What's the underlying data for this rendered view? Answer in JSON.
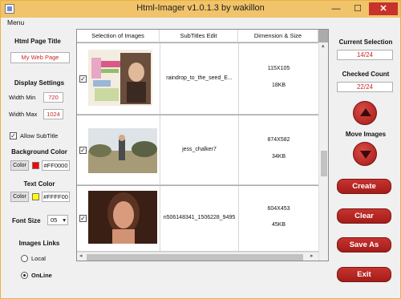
{
  "window": {
    "title": "Html-Imager v1.0.1.3 by wakillon",
    "controls": {
      "minimize": "—",
      "maximize": "☐",
      "close": "✕"
    }
  },
  "menu": {
    "label": "Menu"
  },
  "settings": {
    "page_title_label": "Html Page Title",
    "page_title_value": "My Web Page",
    "display_label": "Display Settings",
    "width_min_label": "Width Min",
    "width_min_value": "720",
    "width_max_label": "Width Max",
    "width_max_value": "1024",
    "allow_subtitle_label": "Allow SubTitle",
    "allow_subtitle_checked": true,
    "bg_color_label": "Background Color",
    "bg_color_button": "Color",
    "bg_color_value": "#FF0000",
    "text_color_label": "Text Color",
    "text_color_button": "Color",
    "text_color_value": "#FFFF00",
    "font_size_label": "Font Size",
    "font_size_value": "05",
    "links_label": "Images Links",
    "links_options": [
      "Local",
      "OnLine"
    ],
    "links_selected": "OnLine"
  },
  "grid": {
    "headers": [
      "Selection of Images",
      "SubTitles Edit",
      "Dimension & Size"
    ],
    "rows": [
      {
        "checked": true,
        "subtitle": "raindrop_to_the_seed_E...",
        "dimension": "115X105",
        "size": "18KB"
      },
      {
        "checked": true,
        "subtitle": "jess_chalker7",
        "dimension": "874X582",
        "size": "34KB"
      },
      {
        "checked": true,
        "subtitle": "n506148341_1506228_9495",
        "dimension": "604X453",
        "size": "45KB"
      }
    ]
  },
  "status": {
    "current_selection_label": "Current Selection",
    "current_selection_value": "14/24",
    "checked_count_label": "Checked Count",
    "checked_count_value": "22/24",
    "move_images_label": "Move Images"
  },
  "actions": {
    "create": "Create",
    "clear": "Clear",
    "save_as": "Save As",
    "exit": "Exit"
  },
  "icons": {
    "check": "✓",
    "scroll_left": "◂",
    "scroll_right": "▸",
    "scroll_up": "▴",
    "scroll_down": "▾",
    "dropdown": "▾"
  },
  "colors": {
    "title_bar": "#f1c36a",
    "accent_red": "#c8282b",
    "bg_swatch": "#FF0000",
    "text_swatch": "#FFFF00"
  }
}
